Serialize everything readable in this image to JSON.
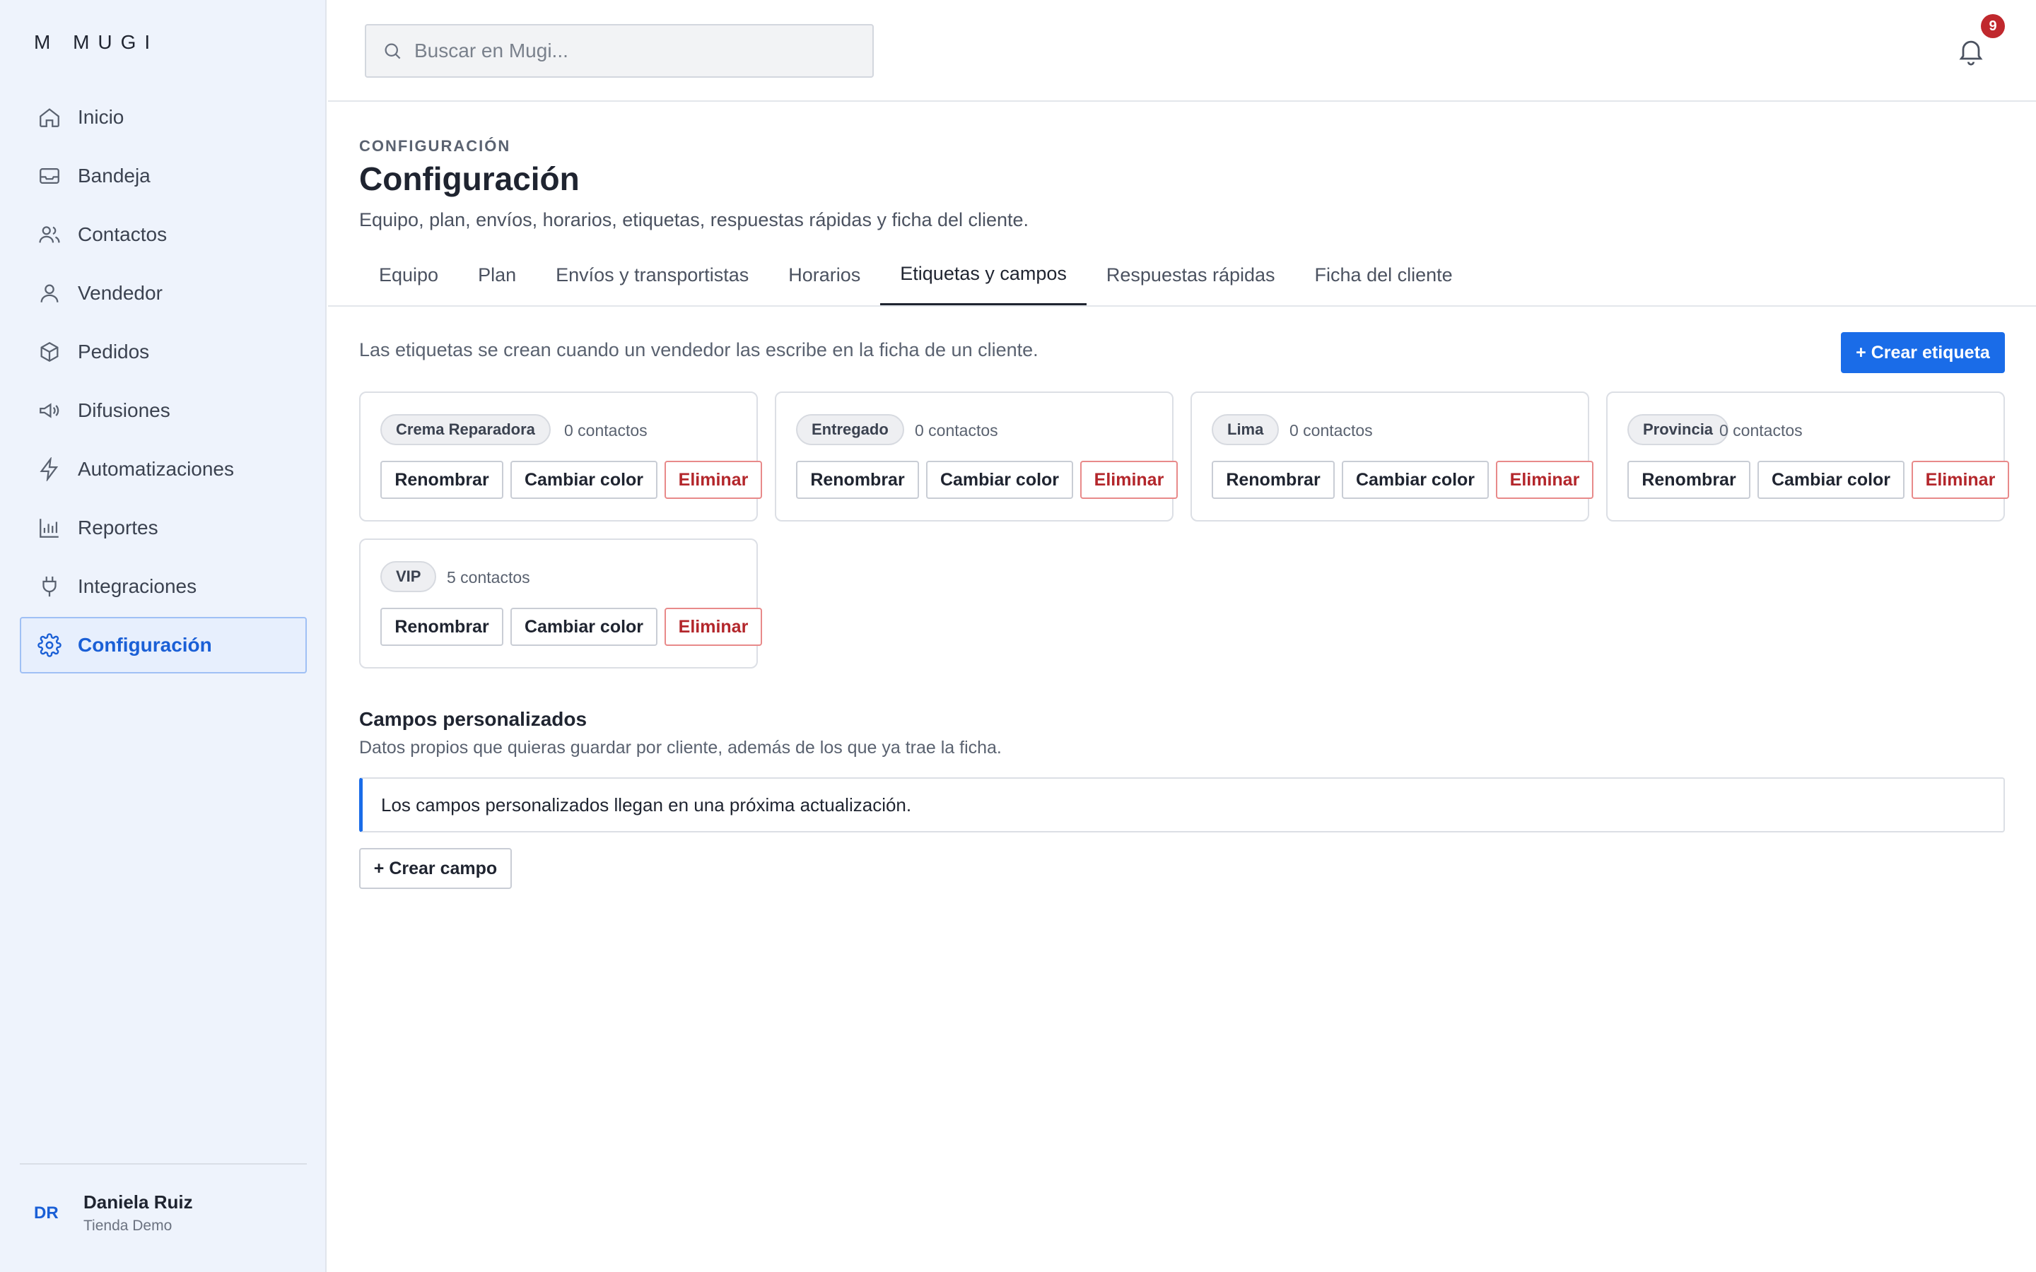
{
  "brand": "M  MUGI",
  "sidebar": {
    "items": [
      {
        "label": "Inicio",
        "icon": "home-icon"
      },
      {
        "label": "Bandeja",
        "icon": "inbox-icon"
      },
      {
        "label": "Contactos",
        "icon": "users-icon"
      },
      {
        "label": "Vendedor",
        "icon": "user-icon"
      },
      {
        "label": "Pedidos",
        "icon": "box-icon"
      },
      {
        "label": "Difusiones",
        "icon": "megaphone-icon"
      },
      {
        "label": "Automatizaciones",
        "icon": "bolt-icon"
      },
      {
        "label": "Reportes",
        "icon": "bar-chart-icon"
      },
      {
        "label": "Integraciones",
        "icon": "plug-icon"
      },
      {
        "label": "Configuración",
        "icon": "gear-icon",
        "active": true
      }
    ],
    "user": {
      "initials": "DR",
      "name": "Daniela Ruiz",
      "store": "Tienda Demo"
    }
  },
  "topbar": {
    "search_placeholder": "Buscar en Mugi...",
    "notifications_count": "9"
  },
  "page": {
    "eyebrow": "CONFIGURACIÓN",
    "title": "Configuración",
    "subtitle": "Equipo, plan, envíos, horarios, etiquetas, respuestas rápidas y ficha del cliente.",
    "tabs": [
      {
        "label": "Equipo"
      },
      {
        "label": "Plan"
      },
      {
        "label": "Envíos y transportistas"
      },
      {
        "label": "Horarios"
      },
      {
        "label": "Etiquetas y campos",
        "active": true
      },
      {
        "label": "Respuestas rápidas"
      },
      {
        "label": "Ficha del cliente"
      }
    ],
    "tags_note": "Las etiquetas se crean cuando un vendedor las escribe en la ficha de un cliente.",
    "create_tag_label": "+ Crear etiqueta",
    "tags": [
      {
        "name": "Crema Reparadora",
        "count": "0 contactos"
      },
      {
        "name": "Entregado",
        "count": "0 contactos"
      },
      {
        "name": "Lima",
        "count": "0 contactos"
      },
      {
        "name": "Provincia",
        "count": "0 contactos"
      },
      {
        "name": "VIP",
        "count": "5 contactos"
      }
    ],
    "tag_actions": {
      "rename": "Renombrar",
      "color": "Cambiar color",
      "delete": "Eliminar"
    },
    "custom_fields": {
      "title": "Campos personalizados",
      "subtitle": "Datos propios que quieras guardar por cliente, además de los que ya trae la ficha.",
      "info": "Los campos personalizados llegan en una próxima actualización.",
      "create_label": "+ Crear campo"
    }
  },
  "colors": {
    "accent": "#1a6ce8",
    "danger": "#b3262b",
    "sidebar_bg": "#eef3fc",
    "badge": "#c0282d"
  }
}
